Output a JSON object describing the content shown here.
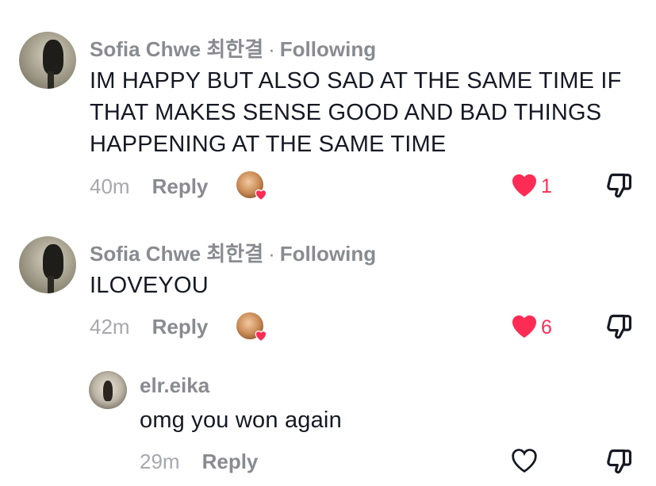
{
  "comments": [
    {
      "username": "Sofia Chwe 최한결",
      "separator": "·",
      "relation": "Following",
      "lines": [
        "IM HAPPY BUT ALSO SAD AT THE SAME TIME IF",
        "THAT MAKES SENSE GOOD AND BAD THINGS",
        "HAPPENING AT THE SAME TIME"
      ],
      "time": "40m",
      "reply_label": "Reply",
      "liked": true,
      "like_count": "1",
      "creator_liked": true
    },
    {
      "username": "Sofia Chwe 최한결",
      "separator": "·",
      "relation": "Following",
      "lines": [
        "ILOVEYOU"
      ],
      "time": "42m",
      "reply_label": "Reply",
      "liked": true,
      "like_count": "6",
      "creator_liked": true
    },
    {
      "username": "elr.eika",
      "lines": [
        "omg you won again"
      ],
      "time": "29m",
      "reply_label": "Reply",
      "liked": false
    }
  ],
  "icons": {
    "like_filled": "heart-filled-icon",
    "like_outline": "heart-outline-icon",
    "dislike": "thumbs-down-icon",
    "creator_like": "creator-liked-badge"
  },
  "colors": {
    "like": "#fe2c55",
    "meta": "#8a8b91",
    "text": "#161823"
  }
}
